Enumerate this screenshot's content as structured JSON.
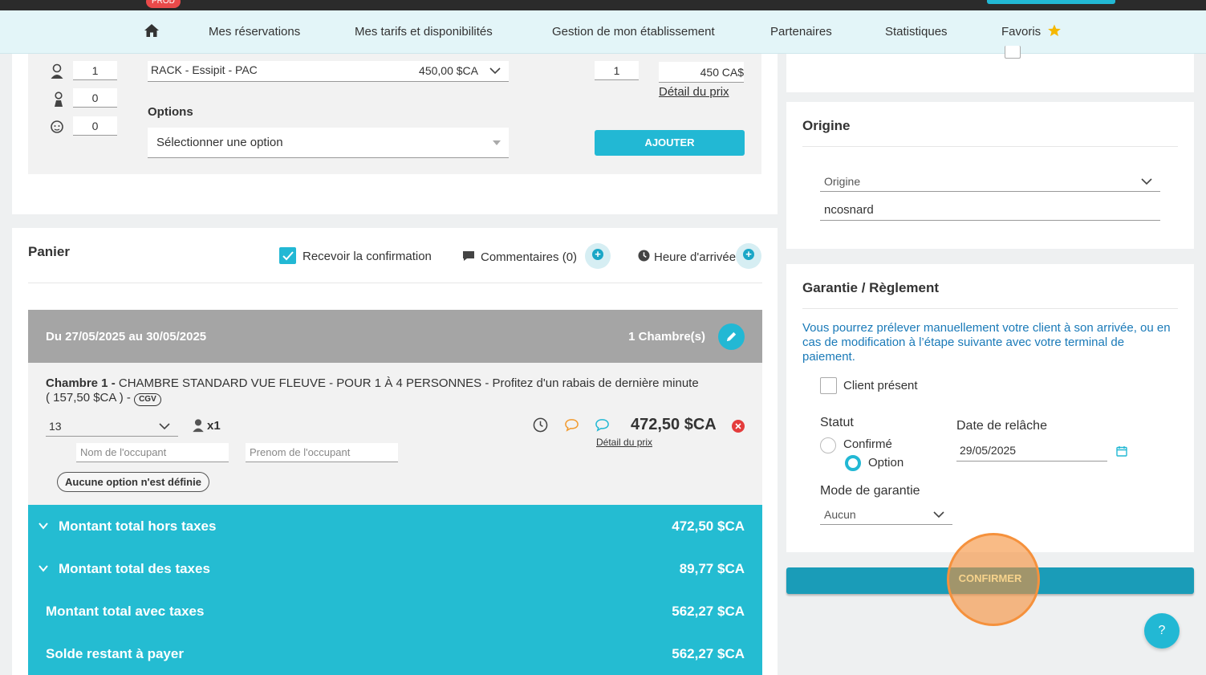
{
  "topbar": {
    "env_badge": "PROD"
  },
  "nav": {
    "items": [
      "Mes réservations",
      "Mes tarifs et disponibilités",
      "Gestion de mon établissement",
      "Partenaires",
      "Statistiques",
      "Favoris"
    ]
  },
  "booking_form": {
    "adults": "1",
    "children": "0",
    "babies": "0",
    "rate_select": "RACK - Essipit - PAC",
    "rate_price": "450,00 $CA",
    "quantity": "1",
    "price": "450",
    "currency": "CA$",
    "price_detail_link": "Détail du prix",
    "options_label": "Options",
    "options_placeholder": "Sélectionner une option",
    "add_button": "AJOUTER"
  },
  "cart": {
    "title": "Panier",
    "receive_confirmation": "Recevoir la confirmation",
    "comments": "Commentaires (0)",
    "arrival_time": "Heure d'arrivée",
    "stay_dates": "Du 27/05/2025 au 30/05/2025",
    "rooms_count": "1 Chambre(s)",
    "room_label": "Chambre 1 -",
    "room_description": "CHAMBRE STANDARD VUE FLEUVE - POUR 1 À 4 PERSONNES - Profitez d'un rabais de dernière minute ( 157,50 $CA ) -",
    "cgv_badge": "CGV",
    "room_number": "13",
    "occupants": "x1",
    "room_price": "472,50 $CA",
    "room_price_detail": "Détail du prix",
    "occupant_last_name_placeholder": "Nom de l'occupant",
    "occupant_first_name_placeholder": "Prenom de l'occupant",
    "no_option_badge": "Aucune option n'est définie",
    "totals": [
      {
        "label": "Montant total hors taxes",
        "value": "472,50 $CA"
      },
      {
        "label": "Montant total des taxes",
        "value": "89,77 $CA"
      },
      {
        "label": "Montant total avec taxes",
        "value": "562,27 $CA"
      },
      {
        "label": "Solde restant à payer",
        "value": "562,27 $CA"
      }
    ]
  },
  "origin": {
    "title": "Origine",
    "select_label": "Origine",
    "value": "ncosnard"
  },
  "guarantee": {
    "title": "Garantie / Règlement",
    "info": "Vous pourrez prélever manuellement votre client à son arrivée, ou en cas de modification à l’étape suivante avec votre terminal de paiement.",
    "client_present": "Client présent",
    "status_label": "Statut",
    "status_confirmed": "Confirmé",
    "status_option": "Option",
    "release_date_label": "Date de relâche",
    "release_date": "29/05/2025",
    "guarantee_mode_label": "Mode de garantie",
    "guarantee_mode": "Aucun"
  },
  "confirm_button": "CONFIRMER",
  "help_button": "?",
  "colors": {
    "accent": "#22b8d4",
    "highlight": "#f5913c",
    "danger": "#e43c3c"
  }
}
